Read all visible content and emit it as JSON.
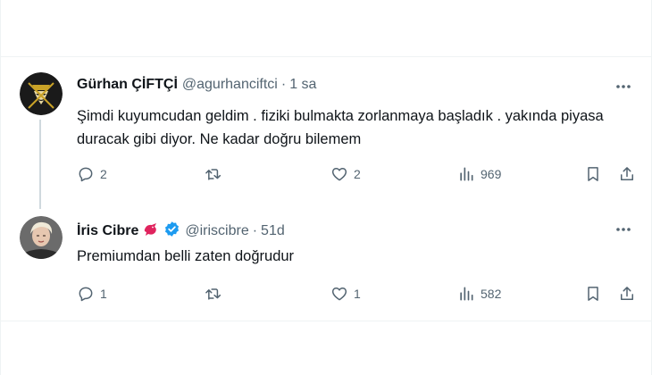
{
  "tweets": [
    {
      "name": "Gürhan ÇİFTÇİ",
      "handle": "@agurhanciftci",
      "time": "1 sa",
      "text": "Şimdi kuyumcudan geldim .  fiziki bulmakta zorlanmaya başladık . yakında piyasa duracak gibi diyor. Ne kadar doğru bilemem",
      "replies": "2",
      "retweets": "",
      "likes": "2",
      "views": "969"
    },
    {
      "name": "İris Cibre",
      "handle": "@iriscibre",
      "time": "51d",
      "text": "Premiumdan belli zaten doğrudur",
      "replies": "1",
      "retweets": "",
      "likes": "1",
      "views": "582",
      "badge_color": "#1d9bf0",
      "emoji_color": "#e0245e"
    }
  ],
  "colors": {
    "text": "#0f1419",
    "secondary": "#536471",
    "divider": "#eff3f4",
    "thread_line": "#cfd9de"
  }
}
